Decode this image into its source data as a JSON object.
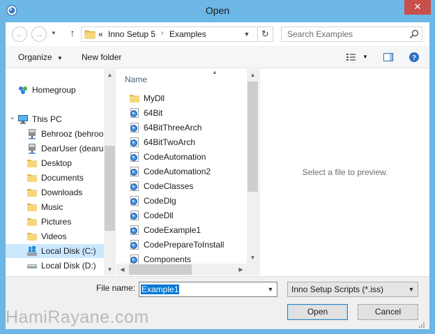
{
  "window": {
    "title": "Open",
    "close_glyph": "✕"
  },
  "address": {
    "overflow_glyph": "«",
    "crumbs": [
      "Inno Setup 5",
      "Examples"
    ]
  },
  "search": {
    "placeholder": "Search Examples"
  },
  "toolbar": {
    "organize_label": "Organize",
    "new_folder_label": "New folder"
  },
  "nav_pane": {
    "items": [
      {
        "label": "Homegroup",
        "icon": "homegroup-icon"
      },
      {
        "label": "This PC",
        "icon": "computer-icon"
      },
      {
        "label": "Behrooz (behroo",
        "icon": "network-drive-icon"
      },
      {
        "label": "DearUser (dearus",
        "icon": "network-drive-icon"
      },
      {
        "label": "Desktop",
        "icon": "folder-icon"
      },
      {
        "label": "Documents",
        "icon": "folder-icon"
      },
      {
        "label": "Downloads",
        "icon": "folder-icon"
      },
      {
        "label": "Music",
        "icon": "folder-icon"
      },
      {
        "label": "Pictures",
        "icon": "folder-icon"
      },
      {
        "label": "Videos",
        "icon": "folder-icon"
      },
      {
        "label": "Local Disk (C:)",
        "icon": "windows-drive-icon"
      },
      {
        "label": "Local Disk (D:)",
        "icon": "drive-icon"
      }
    ],
    "selected": "Local Disk (C:)"
  },
  "file_list": {
    "column_header": "Name",
    "items": [
      {
        "label": "MyDll",
        "icon": "folder-icon"
      },
      {
        "label": "64Bit",
        "icon": "iss-file-icon"
      },
      {
        "label": "64BitThreeArch",
        "icon": "iss-file-icon"
      },
      {
        "label": "64BitTwoArch",
        "icon": "iss-file-icon"
      },
      {
        "label": "CodeAutomation",
        "icon": "iss-file-icon"
      },
      {
        "label": "CodeAutomation2",
        "icon": "iss-file-icon"
      },
      {
        "label": "CodeClasses",
        "icon": "iss-file-icon"
      },
      {
        "label": "CodeDlg",
        "icon": "iss-file-icon"
      },
      {
        "label": "CodeDll",
        "icon": "iss-file-icon"
      },
      {
        "label": "CodeExample1",
        "icon": "iss-file-icon"
      },
      {
        "label": "CodePrepareToInstall",
        "icon": "iss-file-icon"
      },
      {
        "label": "Components",
        "icon": "iss-file-icon"
      }
    ]
  },
  "preview": {
    "message": "Select a file to preview."
  },
  "bottom": {
    "file_name_label": "File name:",
    "file_name_value": "Example1",
    "file_type_value": "Inno Setup Scripts (*.iss)",
    "open_label": "Open",
    "cancel_label": "Cancel"
  },
  "watermark": "HamiRayane.com",
  "colors": {
    "title_bar": "#6cb7e6",
    "close": "#c7504c",
    "selection": "#cce8ff",
    "highlight": "#0078d7"
  }
}
